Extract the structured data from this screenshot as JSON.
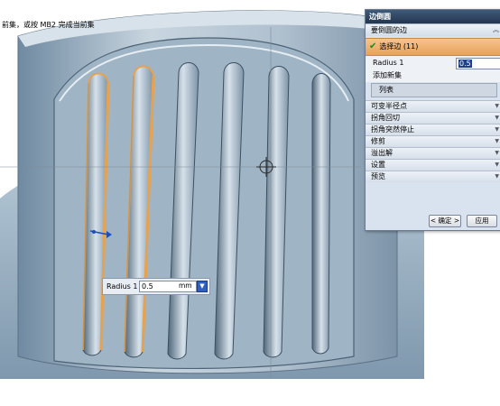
{
  "status_bar": {
    "text": "前集，或按 MB2 完成当前集"
  },
  "dialog": {
    "title": "边倒圆",
    "group_title": "要倒圆的边",
    "select_edge_label": "选择边 (11)",
    "radius_label": "Radius 1",
    "radius_value": "0.5",
    "add_set_label": "添加新集",
    "list_label": "列表",
    "collapsed_sections": [
      "可变半径点",
      "拐角回切",
      "拐角突然停止",
      "修剪",
      "溢出解",
      "设置",
      "预览"
    ],
    "ok_label": "< 确定 >",
    "apply_label": "应用"
  },
  "onscreen_input": {
    "label": "Radius 1",
    "value": "0.5",
    "unit": "mm"
  },
  "colors": {
    "highlight_edge": "#e7a24e",
    "model_body": "#b8c9d6",
    "dialog_bg": "#d9e3ef"
  }
}
